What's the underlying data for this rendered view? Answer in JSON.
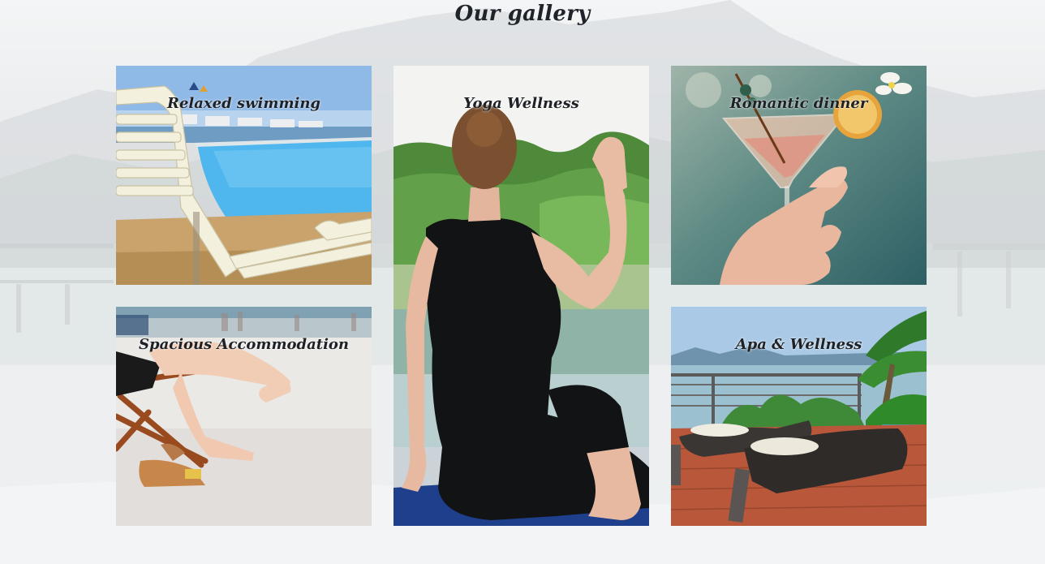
{
  "section": {
    "title": "Our gallery"
  },
  "gallery": {
    "items": [
      {
        "caption": "Relaxed swimming",
        "image": "pool-loungers-photo"
      },
      {
        "caption": "Yoga Wellness",
        "image": "yoga-lake-photo"
      },
      {
        "caption": "Romantic dinner",
        "image": "cocktail-glass-photo"
      },
      {
        "caption": "Spacious Accommodation",
        "image": "beach-chair-legs-photo"
      },
      {
        "caption": "Apa & Wellness",
        "image": "deck-loungers-sea-photo"
      }
    ]
  },
  "colors": {
    "title_text": "#1f232a",
    "caption_text": "#1e2126",
    "background": "#e9ecee"
  }
}
